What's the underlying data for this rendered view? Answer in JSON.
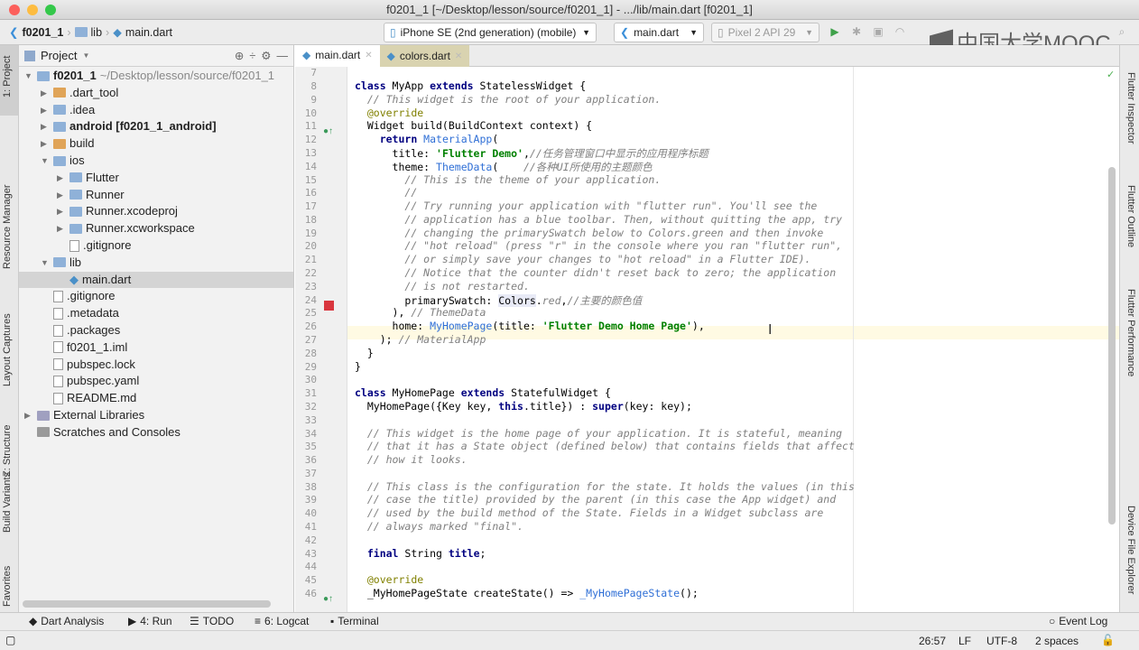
{
  "window": {
    "title": "f0201_1 [~/Desktop/lesson/source/f0201_1] - .../lib/main.dart [f0201_1]"
  },
  "breadcrumb": [
    "f0201_1",
    "lib",
    "main.dart"
  ],
  "toolbar": {
    "device": "iPhone SE (2nd generation) (mobile)",
    "run_config": "main.dart",
    "emulator": "Pixel 2 API 29"
  },
  "watermark": "中国大学MOOC",
  "left_strip": [
    "1: Project",
    "Resource Manager",
    "Layout Captures",
    "Z: Structure",
    "Build Variants",
    "Favorites"
  ],
  "right_strip": [
    "Flutter Inspector",
    "Flutter Outline",
    "Flutter Performance",
    "Device File Explorer"
  ],
  "project": {
    "header": "Project",
    "items": [
      {
        "label": "f0201_1",
        "suffix": " ~/Desktop/lesson/source/f0201_1",
        "level": 0,
        "arrow": "▼",
        "kind": "folder",
        "bold": true
      },
      {
        "label": ".dart_tool",
        "level": 1,
        "arrow": "▶",
        "kind": "folder-orange"
      },
      {
        "label": ".idea",
        "level": 1,
        "arrow": "▶",
        "kind": "folder"
      },
      {
        "label": "android [f0201_1_android]",
        "level": 1,
        "arrow": "▶",
        "kind": "folder-green",
        "bold": true
      },
      {
        "label": "build",
        "level": 1,
        "arrow": "▶",
        "kind": "folder-orange"
      },
      {
        "label": "ios",
        "level": 1,
        "arrow": "▼",
        "kind": "folder"
      },
      {
        "label": "Flutter",
        "level": 2,
        "arrow": "▶",
        "kind": "folder"
      },
      {
        "label": "Runner",
        "level": 2,
        "arrow": "▶",
        "kind": "folder"
      },
      {
        "label": "Runner.xcodeproj",
        "level": 2,
        "arrow": "▶",
        "kind": "folder"
      },
      {
        "label": "Runner.xcworkspace",
        "level": 2,
        "arrow": "▶",
        "kind": "folder"
      },
      {
        "label": ".gitignore",
        "level": 2,
        "arrow": "",
        "kind": "file"
      },
      {
        "label": "lib",
        "level": 1,
        "arrow": "▼",
        "kind": "folder"
      },
      {
        "label": "main.dart",
        "level": 2,
        "arrow": "",
        "kind": "dart",
        "selected": true
      },
      {
        "label": ".gitignore",
        "level": 1,
        "arrow": "",
        "kind": "file"
      },
      {
        "label": ".metadata",
        "level": 1,
        "arrow": "",
        "kind": "file"
      },
      {
        "label": ".packages",
        "level": 1,
        "arrow": "",
        "kind": "file"
      },
      {
        "label": "f0201_1.iml",
        "level": 1,
        "arrow": "",
        "kind": "file"
      },
      {
        "label": "pubspec.lock",
        "level": 1,
        "arrow": "",
        "kind": "file"
      },
      {
        "label": "pubspec.yaml",
        "level": 1,
        "arrow": "",
        "kind": "file"
      },
      {
        "label": "README.md",
        "level": 1,
        "arrow": "",
        "kind": "file"
      },
      {
        "label": "External Libraries",
        "level": 0,
        "arrow": "▶",
        "kind": "lib"
      },
      {
        "label": "Scratches and Consoles",
        "level": 0,
        "arrow": "",
        "kind": "scratch"
      }
    ]
  },
  "tabs": [
    {
      "label": "main.dart",
      "active": true
    },
    {
      "label": "colors.dart",
      "active": false
    }
  ],
  "code": [
    {
      "n": "7",
      "s": []
    },
    {
      "n": "8",
      "s": [
        [
          "kw",
          "class "
        ],
        [
          "",
          "MyApp "
        ],
        [
          "kw",
          "extends "
        ],
        [
          "",
          "StatelessWidget {"
        ]
      ]
    },
    {
      "n": "9",
      "s": [
        [
          "",
          "  "
        ],
        [
          "cm",
          "// This widget is the root of your application."
        ]
      ]
    },
    {
      "n": "10",
      "s": [
        [
          "",
          "  "
        ],
        [
          "ann",
          "@override"
        ]
      ]
    },
    {
      "n": "11",
      "s": [
        [
          "",
          "  Widget build(BuildContext context) {"
        ]
      ]
    },
    {
      "n": "12",
      "s": [
        [
          "",
          "    "
        ],
        [
          "kw",
          "return "
        ],
        [
          "typ",
          "MaterialApp"
        ],
        [
          "",
          "("
        ]
      ]
    },
    {
      "n": "13",
      "s": [
        [
          "",
          "      title: "
        ],
        [
          "str",
          "'Flutter Demo'"
        ],
        [
          "",
          ","
        ],
        [
          "cm",
          "//任务管理窗口中显示的应用程序标题"
        ]
      ]
    },
    {
      "n": "14",
      "s": [
        [
          "",
          "      theme: "
        ],
        [
          "typ",
          "ThemeData"
        ],
        [
          "",
          "(    "
        ],
        [
          "cm",
          "//各种UI所使用的主题颜色"
        ]
      ]
    },
    {
      "n": "15",
      "s": [
        [
          "",
          "        "
        ],
        [
          "cm",
          "// This is the theme of your application."
        ]
      ]
    },
    {
      "n": "16",
      "s": [
        [
          "",
          "        "
        ],
        [
          "cm",
          "//"
        ]
      ]
    },
    {
      "n": "17",
      "s": [
        [
          "",
          "        "
        ],
        [
          "cm",
          "// Try running your application with \"flutter run\". You'll see the"
        ]
      ]
    },
    {
      "n": "18",
      "s": [
        [
          "",
          "        "
        ],
        [
          "cm",
          "// application has a blue toolbar. Then, without quitting the app, try"
        ]
      ]
    },
    {
      "n": "19",
      "s": [
        [
          "",
          "        "
        ],
        [
          "cm",
          "// changing the primarySwatch below to Colors.green and then invoke"
        ]
      ]
    },
    {
      "n": "20",
      "s": [
        [
          "",
          "        "
        ],
        [
          "cm",
          "// \"hot reload\" (press \"r\" in the console where you ran \"flutter run\","
        ]
      ]
    },
    {
      "n": "21",
      "s": [
        [
          "",
          "        "
        ],
        [
          "cm",
          "// or simply save your changes to \"hot reload\" in a Flutter IDE)."
        ]
      ]
    },
    {
      "n": "22",
      "s": [
        [
          "",
          "        "
        ],
        [
          "cm",
          "// Notice that the counter didn't reset back to zero; the application"
        ]
      ]
    },
    {
      "n": "23",
      "s": [
        [
          "",
          "        "
        ],
        [
          "cm",
          "// is not restarted."
        ]
      ]
    },
    {
      "n": "24",
      "s": [
        [
          "",
          "        primarySwatch: "
        ],
        [
          "hl",
          "Colors"
        ],
        [
          "",
          "."
        ],
        [
          "cm",
          "red"
        ],
        [
          "",
          ","
        ],
        [
          "cm",
          "//主要的颜色值"
        ]
      ]
    },
    {
      "n": "25",
      "s": [
        [
          "",
          "      ), "
        ],
        [
          "cm",
          "// ThemeData"
        ]
      ]
    },
    {
      "n": "26",
      "s": [
        [
          "",
          "      home: "
        ],
        [
          "typ",
          "MyHomePage"
        ],
        [
          "",
          "(title: "
        ],
        [
          "str",
          "'Flutter Demo Home Page'"
        ],
        [
          "",
          "),"
        ]
      ]
    },
    {
      "n": "27",
      "s": [
        [
          "",
          "    ); "
        ],
        [
          "cm",
          "// MaterialApp"
        ]
      ]
    },
    {
      "n": "28",
      "s": [
        [
          "",
          "  }"
        ]
      ]
    },
    {
      "n": "29",
      "s": [
        [
          "",
          "}"
        ]
      ]
    },
    {
      "n": "30",
      "s": []
    },
    {
      "n": "31",
      "s": [
        [
          "kw",
          "class "
        ],
        [
          "",
          "MyHomePage "
        ],
        [
          "kw",
          "extends "
        ],
        [
          "",
          "StatefulWidget {"
        ]
      ]
    },
    {
      "n": "32",
      "s": [
        [
          "",
          "  MyHomePage({Key key, "
        ],
        [
          "kw",
          "this"
        ],
        [
          "",
          ".title}) : "
        ],
        [
          "kw",
          "super"
        ],
        [
          "",
          "(key: key);"
        ]
      ]
    },
    {
      "n": "33",
      "s": []
    },
    {
      "n": "34",
      "s": [
        [
          "",
          "  "
        ],
        [
          "cm",
          "// This widget is the home page of your application. It is stateful, meaning"
        ]
      ]
    },
    {
      "n": "35",
      "s": [
        [
          "",
          "  "
        ],
        [
          "cm",
          "// that it has a State object (defined below) that contains fields that affect"
        ]
      ]
    },
    {
      "n": "36",
      "s": [
        [
          "",
          "  "
        ],
        [
          "cm",
          "// how it looks."
        ]
      ]
    },
    {
      "n": "37",
      "s": []
    },
    {
      "n": "38",
      "s": [
        [
          "",
          "  "
        ],
        [
          "cm",
          "// This class is the configuration for the state. It holds the values (in this"
        ]
      ]
    },
    {
      "n": "39",
      "s": [
        [
          "",
          "  "
        ],
        [
          "cm",
          "// case the title) provided by the parent (in this case the App widget) and"
        ]
      ]
    },
    {
      "n": "40",
      "s": [
        [
          "",
          "  "
        ],
        [
          "cm",
          "// used by the build method of the State. Fields in a Widget subclass are"
        ]
      ]
    },
    {
      "n": "41",
      "s": [
        [
          "",
          "  "
        ],
        [
          "cm",
          "// always marked \"final\"."
        ]
      ]
    },
    {
      "n": "42",
      "s": []
    },
    {
      "n": "43",
      "s": [
        [
          "",
          "  "
        ],
        [
          "kw",
          "final "
        ],
        [
          "",
          "String "
        ],
        [
          "kw",
          "title"
        ],
        [
          "",
          ";"
        ]
      ]
    },
    {
      "n": "44",
      "s": []
    },
    {
      "n": "45",
      "s": [
        [
          "",
          "  "
        ],
        [
          "ann",
          "@override"
        ]
      ]
    },
    {
      "n": "46",
      "s": [
        [
          "",
          "  _MyHomePageState createState() => "
        ],
        [
          "typ",
          "_MyHomePageState"
        ],
        [
          "",
          "();"
        ]
      ]
    }
  ],
  "bottom_tools": {
    "dart_analysis": "Dart Analysis",
    "run": "4: Run",
    "todo": "TODO",
    "logcat": "6: Logcat",
    "terminal": "Terminal",
    "event_log": "Event Log"
  },
  "status": {
    "position": "26:57",
    "line_sep": "LF",
    "encoding": "UTF-8",
    "indent": "2 spaces"
  },
  "colors": {
    "breakpoint": "#d9363e",
    "selection": "#d4d4d4",
    "keyword": "#000080",
    "string": "#008000",
    "comment": "#808080"
  }
}
